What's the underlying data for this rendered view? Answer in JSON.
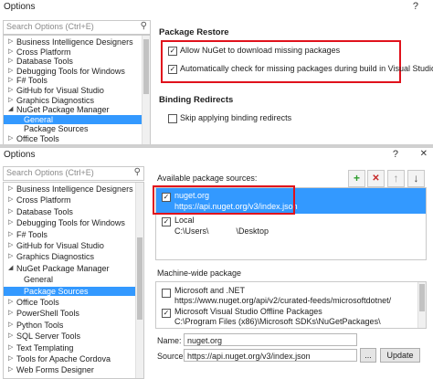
{
  "top": {
    "title": "Options",
    "help": "?",
    "search_placeholder": "Search Options (Ctrl+E)",
    "tree": [
      {
        "label": "Business Intelligence Designers",
        "arrow": "▷"
      },
      {
        "label": "Cross Platform",
        "arrow": "▷"
      },
      {
        "label": "Database Tools",
        "arrow": "▷"
      },
      {
        "label": "Debugging Tools for Windows",
        "arrow": "▷"
      },
      {
        "label": "F# Tools",
        "arrow": "▷"
      },
      {
        "label": "GitHub for Visual Studio",
        "arrow": "▷"
      },
      {
        "label": "Graphics Diagnostics",
        "arrow": "▷"
      },
      {
        "label": "NuGet Package Manager",
        "arrow": "◢"
      },
      {
        "label": "General",
        "arrow": ""
      },
      {
        "label": "Package Sources",
        "arrow": ""
      },
      {
        "label": "Office Tools",
        "arrow": "▷"
      }
    ],
    "package_restore_heading": "Package Restore",
    "allow_download_label": "Allow NuGet to download missing packages",
    "auto_check_label": "Automatically check for missing packages during build in Visual Studio",
    "binding_redirects_heading": "Binding Redirects",
    "skip_binding_label": "Skip applying binding redirects"
  },
  "bottom": {
    "title": "Options",
    "help": "?",
    "close": "✕",
    "search_placeholder": "Search Options (Ctrl+E)",
    "tree": [
      {
        "label": "Business Intelligence Designers",
        "arrow": "▷"
      },
      {
        "label": "Cross Platform",
        "arrow": "▷"
      },
      {
        "label": "Database Tools",
        "arrow": "▷"
      },
      {
        "label": "Debugging Tools for Windows",
        "arrow": "▷"
      },
      {
        "label": "F# Tools",
        "arrow": "▷"
      },
      {
        "label": "GitHub for Visual Studio",
        "arrow": "▷"
      },
      {
        "label": "Graphics Diagnostics",
        "arrow": "▷"
      },
      {
        "label": "NuGet Package Manager",
        "arrow": "◢"
      },
      {
        "label": "General",
        "arrow": ""
      },
      {
        "label": "Package Sources",
        "arrow": ""
      },
      {
        "label": "Office Tools",
        "arrow": "▷"
      },
      {
        "label": "PowerShell Tools",
        "arrow": "▷"
      },
      {
        "label": "Python Tools",
        "arrow": "▷"
      },
      {
        "label": "SQL Server Tools",
        "arrow": "▷"
      },
      {
        "label": "Text Templating",
        "arrow": "▷"
      },
      {
        "label": "Tools for Apache Cordova",
        "arrow": "▷"
      },
      {
        "label": "Web Forms Designer",
        "arrow": "▷"
      }
    ],
    "available_heading": "Available package sources:",
    "sources": [
      {
        "name": "nuget.org",
        "url": "https://api.nuget.org/v3/index.json"
      },
      {
        "name": "Local",
        "url": "C:\\Users\\            \\Desktop"
      }
    ],
    "machine_wide_heading": "Machine-wide package",
    "machine_sources": [
      {
        "name": "Microsoft and .NET",
        "url": "https://www.nuget.org/api/v2/curated-feeds/microsoftdotnet/"
      },
      {
        "name": "Microsoft Visual Studio Offline Packages",
        "url": "C:\\Program Files (x86)\\Microsoft SDKs\\NuGetPackages\\"
      }
    ],
    "name_label": "Name:",
    "name_value": "nuget.org",
    "source_label": "Source:",
    "source_value": "https://api.nuget.org/v3/index.json",
    "browse_label": "...",
    "update_label": "Update",
    "icons": {
      "add": "+",
      "remove": "✕",
      "up": "↑",
      "down": "↓",
      "search": "⚲"
    },
    "colors": {
      "selection": "#3399ff",
      "highlight": "#e0121c",
      "add": "#2e9e2e",
      "remove": "#c62828"
    }
  }
}
